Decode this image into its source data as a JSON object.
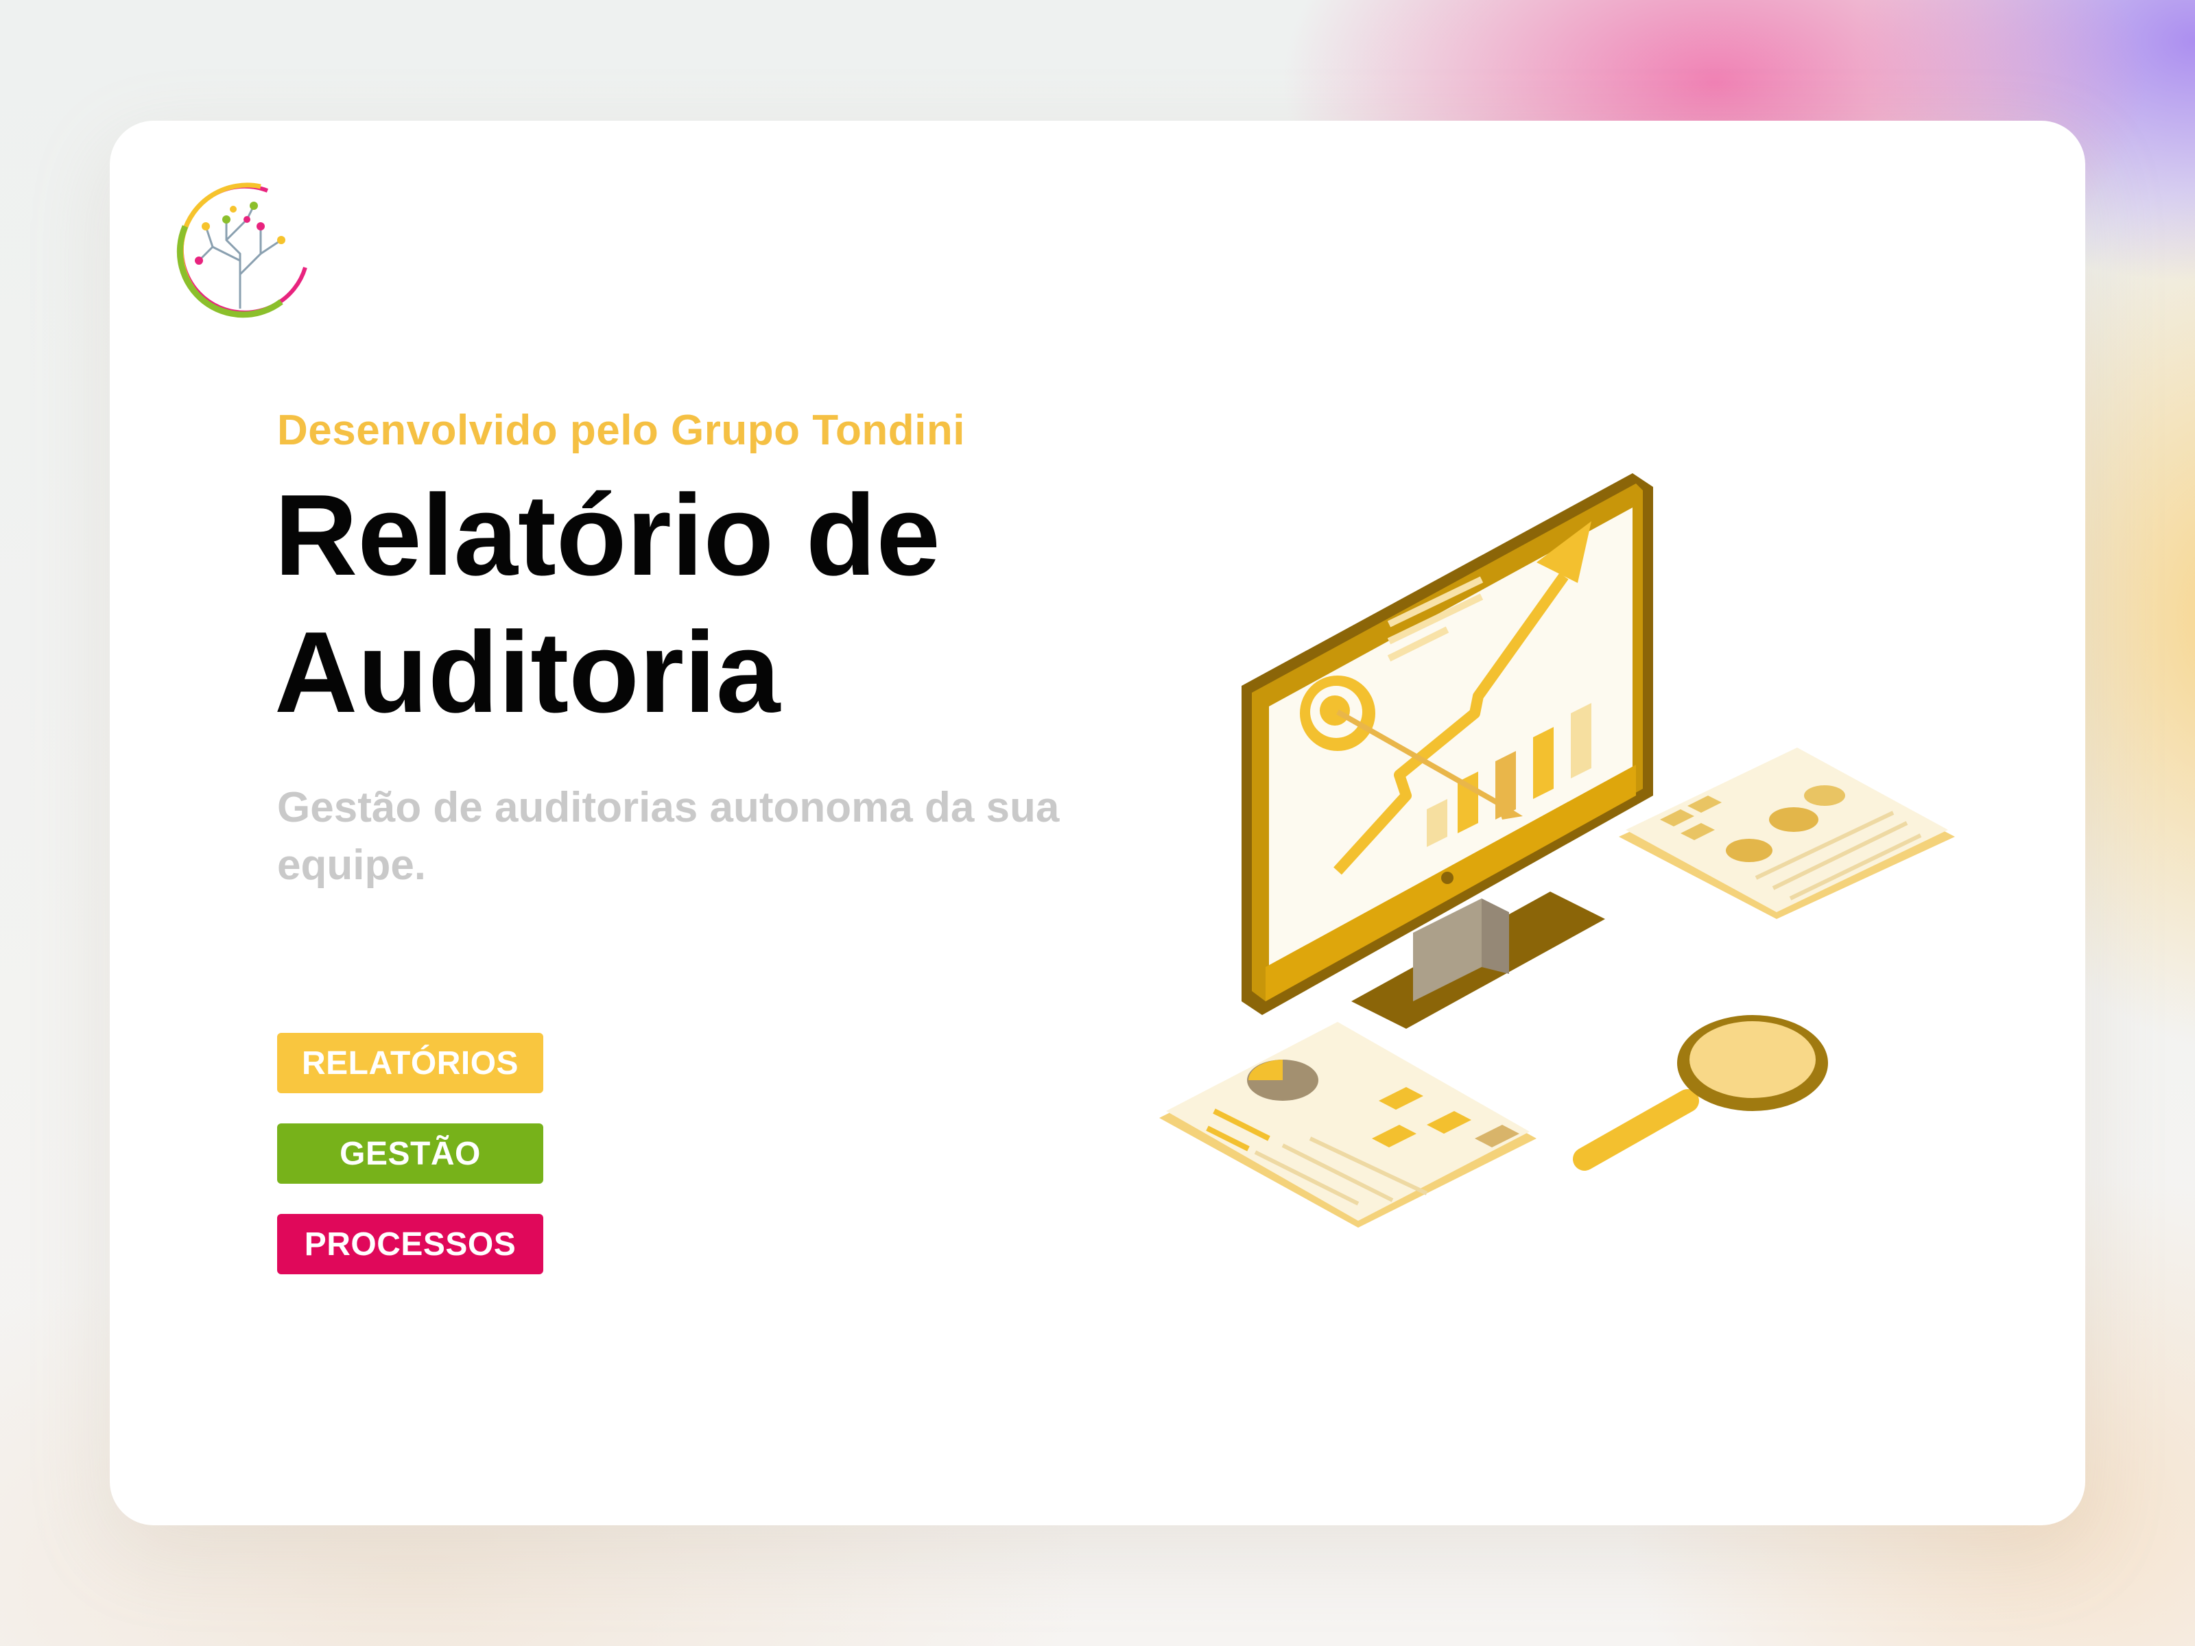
{
  "hero": {
    "subtitle": "Desenvolvido pelo Grupo Tondini",
    "title_line1": "Relatório de",
    "title_line2": "Auditoria",
    "description": "Gestão de auditorias autonoma da sua equipe."
  },
  "buttons": [
    {
      "label": "RELATÓRIOS",
      "color": "#f9c63f"
    },
    {
      "label": "GESTÃO",
      "color": "#77b21a"
    },
    {
      "label": "PROCESSOS",
      "color": "#e0085a"
    }
  ],
  "icons": {
    "logo": "tree-network-logo",
    "illustration": "monitor-growth-chart-illustration"
  },
  "colors": {
    "accent_yellow": "#f5c043",
    "monitor_gold": "#c8960a",
    "green": "#77b21a",
    "magenta": "#e0085a"
  }
}
